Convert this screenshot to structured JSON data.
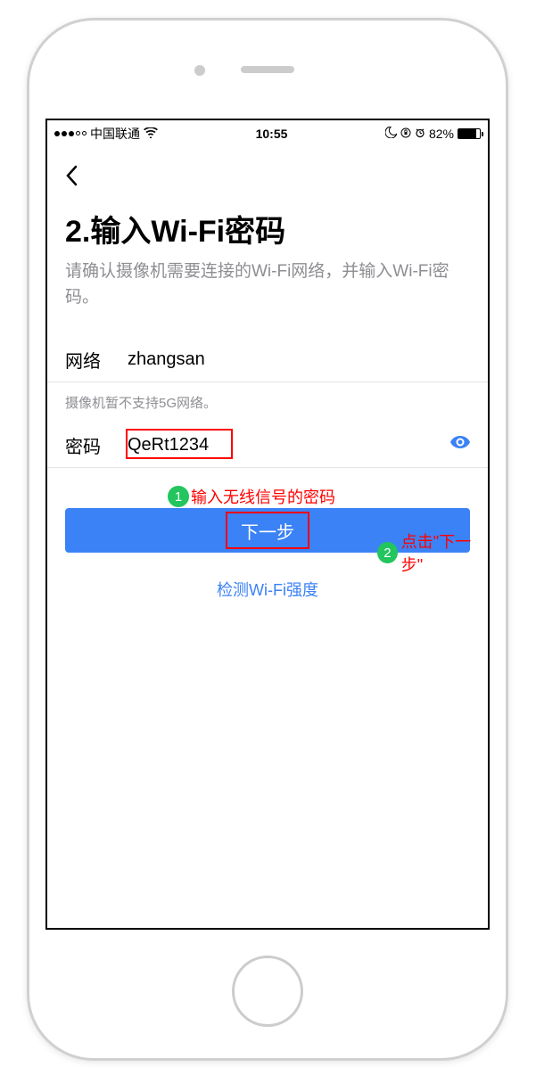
{
  "status_bar": {
    "carrier": "中国联通",
    "time": "10:55",
    "battery_percent": "82%"
  },
  "page": {
    "title": "2.输入Wi-Fi密码",
    "subtitle": "请确认摄像机需要连接的Wi-Fi网络，并输入Wi-Fi密码。",
    "network_label": "网络",
    "network_value": "zhangsan",
    "note_5g": "摄像机暂不支持5G网络。",
    "password_label": "密码",
    "password_value": "QeRt1234",
    "next_button": "下一步",
    "check_wifi": "检测Wi-Fi强度"
  },
  "annotations": {
    "step1_badge": "1",
    "step1_text": "输入无线信号的密码",
    "step2_badge": "2",
    "step2_text": "点击\"下一步\""
  }
}
